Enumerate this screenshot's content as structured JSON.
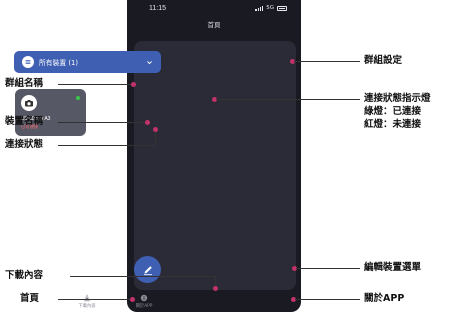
{
  "status_bar": {
    "time": "11:15",
    "network": "5G"
  },
  "page_title": "首頁",
  "group_selector": {
    "label": "所有裝置 (1)",
    "icon": "list-icon",
    "chevron": "chevron-down-icon"
  },
  "group_name": "預設 (1)",
  "device_card": {
    "name": "UltraDash A3",
    "status": "已可連接",
    "icon": "camera-icon",
    "status_indicator_color": "#37c84a"
  },
  "fab": {
    "icon": "pencil-icon",
    "color": "#3f5fb3"
  },
  "bottom_nav": {
    "items": [
      {
        "label": "首頁",
        "icon": "home-icon"
      },
      {
        "label": "下載內容",
        "icon": "download-icon"
      },
      {
        "label": "關於APP",
        "icon": "info-icon"
      }
    ]
  },
  "annotations": {
    "group_name": "群組名稱",
    "device_name": "裝置名稱",
    "connection_status": "連接狀態",
    "download": "下載內容",
    "home": "首頁",
    "group_settings": "群組設定",
    "indicator_title": "連接狀態指示燈",
    "indicator_green": "綠燈：已連接",
    "indicator_red": "紅燈：未連接",
    "edit_menu": "編輯裝置選單",
    "about": "關於APP"
  },
  "colors": {
    "accent": "#3f5fb3",
    "annotation_dot": "#c4326b",
    "phone_bg": "#1a1a22"
  }
}
